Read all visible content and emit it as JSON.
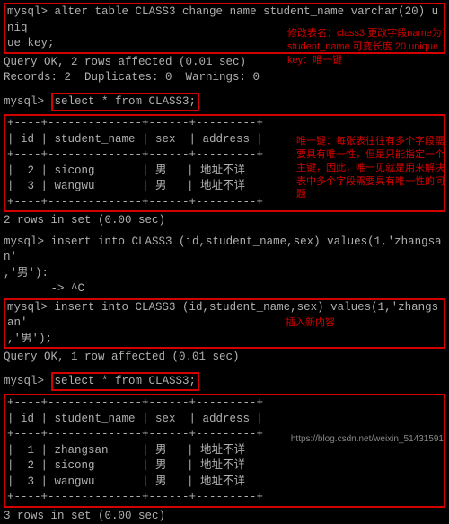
{
  "prompt": "mysql>",
  "cmd1": {
    "line1": "alter table CLASS3 change name student_name varchar(20) uniq",
    "line2": "ue key;"
  },
  "result1": {
    "l1": "Query OK, 2 rows affected (0.01 sec)",
    "l2": "Records: 2  Duplicates: 0  Warnings: 0"
  },
  "ann1": "修改表名：class3 更改字段name为student_name 可变长度 20 unique key：唯一键",
  "cmd2": "select * from CLASS3;",
  "table1": {
    "border": "+----+--------------+------+---------+",
    "header": "| id | student_name | sex  | address |",
    "rows": [
      "|  2 | sicong       | 男   | 地址不详",
      "|  3 | wangwu       | 男   | 地址不详"
    ],
    "summary": "2 rows in set (0.00 sec)"
  },
  "ann2": "唯一键：每张表往往有多个字段需要具有唯一性，但是只能指定一个主键，因此，唯一见就是用来解决表中多个字段需要具有唯一性的问题",
  "cmd3": {
    "l1": "insert into CLASS3 (id,student_name,sex) values(1,'zhangsan'",
    "l2": ",'男'):",
    "l3": "       -> ^C"
  },
  "cmd4": {
    "l1": "insert into CLASS3 (id,student_name,sex) values(1,'zhangsan'",
    "l2": ",'男');"
  },
  "result4": "Query OK, 1 row affected (0.01 sec)",
  "ann3": "插入新内容",
  "cmd5": "select * from CLASS3;",
  "table2": {
    "border": "+----+--------------+------+---------+",
    "header": "| id | student_name | sex  | address |",
    "rows": [
      "|  1 | zhangsan     | 男   | 地址不详",
      "|  2 | sicong       | 男   | 地址不详",
      "|  3 | wangwu       | 男   | 地址不详"
    ],
    "summary": "3 rows in set (0.00 sec)"
  },
  "watermark": "https://blog.csdn.net/weixin_51431591"
}
